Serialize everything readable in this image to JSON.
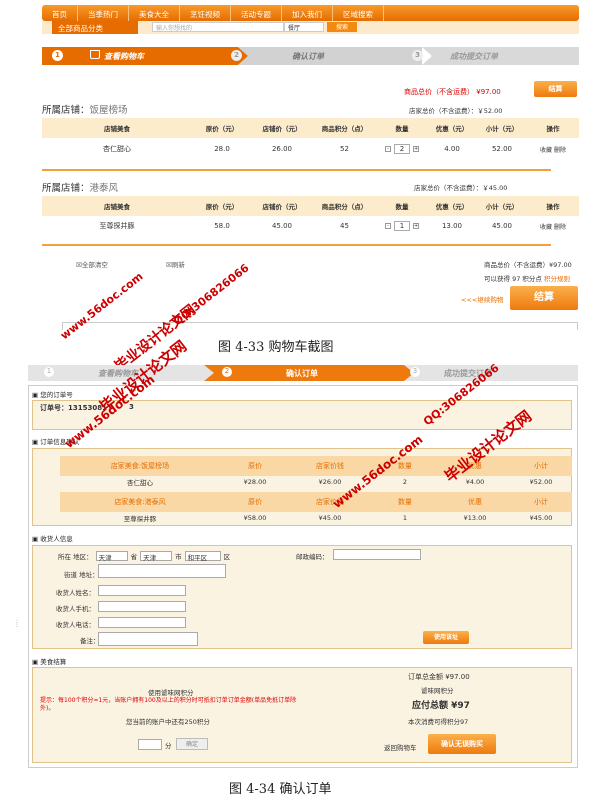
{
  "nav": {
    "items": [
      "首页",
      "当季热门",
      "美食大全",
      "烹饪视频",
      "活动专题",
      "加入我们",
      "区域搜索"
    ],
    "category_button": "全部商品分类",
    "search_placeholder": "输入你想找的",
    "search_select": "餐厅",
    "search_button": "搜索"
  },
  "steps": [
    {
      "num": "1",
      "label": "查看购物车"
    },
    {
      "num": "2",
      "label": "确认订单"
    },
    {
      "num": "3",
      "label": "成功提交订单"
    }
  ],
  "cart": {
    "total_top_label": "商品总价（不含运费）",
    "total_top_value": "¥97.00",
    "checkout_top": "结算",
    "table_headers": [
      "店铺美食",
      "原价（元）",
      "店铺价（元）",
      "商品积分（点）",
      "数量",
      "优惠（元）",
      "小计（元）",
      "操作"
    ],
    "shops": [
      {
        "shop_label": "所属店铺：",
        "shop_name": "饭屋榜场",
        "shop_total": "店家总价（不含运费）：￥52.00",
        "item": {
          "name": "杏仁甜心",
          "orig": "28.0",
          "price": "26.00",
          "points": "52",
          "qty": "2",
          "discount": "4.00",
          "subtotal": "52.00",
          "ops": "收藏 删除"
        }
      },
      {
        "shop_label": "所属店铺：",
        "shop_name": "港泰风",
        "shop_total": "店家总价（不含运费）：￥45.00",
        "item": {
          "name": "至尊探井豚",
          "orig": "58.0",
          "price": "45.00",
          "points": "45",
          "qty": "1",
          "discount": "13.00",
          "subtotal": "45.00",
          "ops": "收藏 删除"
        }
      }
    ],
    "select_all": "全部清空",
    "refresh": "刷新",
    "bottom_total": "商品总价（不含运费）¥97.00",
    "points_line": "可以获得 97 积分点",
    "points_rule": "积分规则",
    "continue": "<<<继续购物",
    "checkout_bottom": "结算"
  },
  "captions": {
    "fig1": "图 4-33  购物车截图",
    "fig2": "图 4-34  确认订单"
  },
  "watermarks": {
    "site": "www.56doc.com",
    "brand": "毕业设计论文网",
    "qq": "QQ:306826066"
  },
  "confirm": {
    "order_no_title": "您的订单号",
    "order_no": "订单号：13153081",
    "order_no_tail": "3",
    "info_title": "订单信息确认",
    "shops": [
      {
        "head": "店家美食:饭屋榜场",
        "cols": [
          "原价",
          "店家价钱",
          "数量",
          "优惠",
          "小计"
        ],
        "row": {
          "name": "杏仁甜心",
          "orig": "¥28.00",
          "price": "¥26.00",
          "qty": "2",
          "disc": "¥4.00",
          "sub": "¥52.00"
        }
      },
      {
        "head": "店家美食:港泰风",
        "cols": [
          "原价",
          "店家价钱",
          "数量",
          "优惠",
          "小计"
        ],
        "row": {
          "name": "至尊探井豚",
          "orig": "¥58.00",
          "price": "¥45.00",
          "qty": "1",
          "disc": "¥13.00",
          "sub": "¥45.00"
        }
      }
    ],
    "receiver_title": "收货人信息",
    "area_label": "所在 地区：",
    "province": "天津",
    "province_unit": "省",
    "city": "天津",
    "city_unit": "市",
    "district": "和平区",
    "district_unit": "区",
    "zip_label": "邮政编码：",
    "street_label": "街道 地址：",
    "name_label": "收货人姓名：",
    "mobile_label": "收货人手机：",
    "phone_label": "收货人电话：",
    "remark_label": "备注：",
    "use_address": "使用该址",
    "settle_title": "美食结算",
    "use_points": "使用谑味网积分",
    "tip": "提示：每100个积分=1元，当账户拥有100及以上的积分时可抵扣订单订单金额(单品免抵订单除外)。",
    "account_points": "您当前的账户中还有250积分",
    "points_unit": "分",
    "confirm_points": "确定",
    "order_total": "订单总金额 ¥97.00",
    "gain_points": "谑味网积分",
    "pay_total": "应付总额 ¥97",
    "consume_points": "本次消费可得积分97",
    "back_cart": "返回购物车",
    "confirm_buy": "确认无误购买"
  }
}
